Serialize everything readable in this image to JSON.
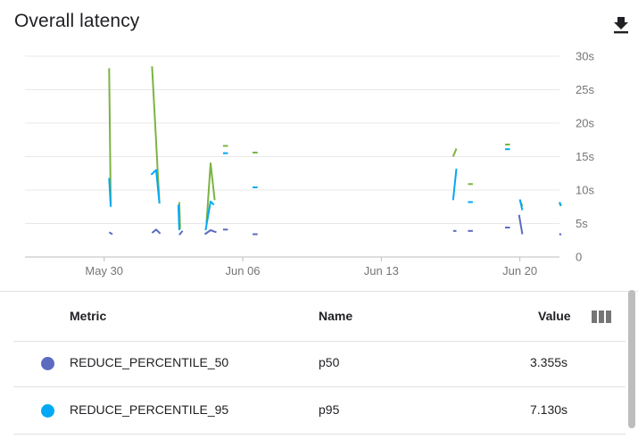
{
  "header": {
    "title": "Overall latency",
    "download_icon": "download-icon"
  },
  "chart_data": {
    "type": "line",
    "title": "",
    "xlabel": "",
    "ylabel": "",
    "x_ticks": [
      "May 30",
      "Jun 06",
      "Jun 13",
      "Jun 20"
    ],
    "y_ticks": [
      "0",
      "5s",
      "10s",
      "15s",
      "20s",
      "25s",
      "30s"
    ],
    "ylim": [
      0,
      30
    ],
    "xlim": [
      "2024-05-26",
      "2024-06-22"
    ],
    "grid": true,
    "y_axis_position": "right",
    "series": [
      {
        "color": "#7cb342",
        "segments": [
          [
            [
              "2024-05-30T06:00",
              28.2
            ],
            [
              "2024-05-30T08:00",
              7.8
            ]
          ],
          [
            [
              "2024-06-01T10:00",
              28.5
            ],
            [
              "2024-06-01T19:00",
              8.0
            ]
          ],
          [
            [
              "2024-06-02T19:00",
              8.2
            ],
            [
              "2024-06-02T20:00",
              4.2
            ]
          ],
          [
            [
              "2024-06-04T04:00",
              5.0
            ],
            [
              "2024-06-04T09:00",
              14.0
            ],
            [
              "2024-06-04T14:00",
              8.5
            ]
          ],
          [
            [
              "2024-06-05T00:00",
              16.6
            ],
            [
              "2024-06-05T06:00",
              16.6
            ]
          ],
          [
            [
              "2024-06-06T12:00",
              15.6
            ],
            [
              "2024-06-06T18:00",
              15.6
            ]
          ],
          [
            [
              "2024-06-16T15:00",
              15.0
            ],
            [
              "2024-06-16T19:00",
              16.2
            ]
          ],
          [
            [
              "2024-06-17T09:00",
              10.9
            ],
            [
              "2024-06-17T15:00",
              10.9
            ]
          ],
          [
            [
              "2024-06-19T06:00",
              16.8
            ],
            [
              "2024-06-19T12:00",
              16.8
            ]
          ],
          [
            [
              "2024-06-20T00:00",
              8.5
            ],
            [
              "2024-06-20T03:00",
              7.6
            ]
          ],
          [
            [
              "2024-06-22T00:00",
              8.0
            ],
            [
              "2024-06-22T02:00",
              7.6
            ]
          ]
        ]
      },
      {
        "color": "#03a9f4",
        "segments": [
          [
            [
              "2024-05-30T06:00",
              11.8
            ],
            [
              "2024-05-30T08:00",
              7.5
            ]
          ],
          [
            [
              "2024-06-01T09:00",
              12.3
            ],
            [
              "2024-06-01T15:00",
              13.0
            ],
            [
              "2024-06-01T19:00",
              8.0
            ]
          ],
          [
            [
              "2024-06-02T18:00",
              7.8
            ],
            [
              "2024-06-02T19:00",
              4.0
            ]
          ],
          [
            [
              "2024-06-04T03:00",
              4.0
            ],
            [
              "2024-06-04T09:00",
              8.3
            ],
            [
              "2024-06-04T13:00",
              7.8
            ]
          ],
          [
            [
              "2024-06-05T00:00",
              15.5
            ],
            [
              "2024-06-05T06:00",
              15.5
            ]
          ],
          [
            [
              "2024-06-06T12:00",
              10.4
            ],
            [
              "2024-06-06T18:00",
              10.4
            ]
          ],
          [
            [
              "2024-06-16T15:00",
              8.5
            ],
            [
              "2024-06-16T19:00",
              13.2
            ]
          ],
          [
            [
              "2024-06-17T09:00",
              8.2
            ],
            [
              "2024-06-17T15:00",
              8.2
            ]
          ],
          [
            [
              "2024-06-19T06:00",
              16.1
            ],
            [
              "2024-06-19T12:00",
              16.1
            ]
          ],
          [
            [
              "2024-06-20T00:00",
              8.6
            ],
            [
              "2024-06-20T03:00",
              7.0
            ]
          ],
          [
            [
              "2024-06-22T00:00",
              8.2
            ],
            [
              "2024-06-22T02:00",
              7.7
            ]
          ]
        ]
      },
      {
        "color": "#5c6bc0",
        "segments": [
          [
            [
              "2024-05-30T06:00",
              3.7
            ],
            [
              "2024-05-30T10:00",
              3.4
            ]
          ],
          [
            [
              "2024-06-01T10:00",
              3.6
            ],
            [
              "2024-06-01T15:00",
              4.1
            ],
            [
              "2024-06-01T20:00",
              3.5
            ]
          ],
          [
            [
              "2024-06-02T19:00",
              3.3
            ],
            [
              "2024-06-02T23:00",
              3.9
            ]
          ],
          [
            [
              "2024-06-04T02:00",
              3.4
            ],
            [
              "2024-06-04T09:00",
              4.0
            ],
            [
              "2024-06-04T16:00",
              3.7
            ]
          ],
          [
            [
              "2024-06-05T00:00",
              4.1
            ],
            [
              "2024-06-05T06:00",
              4.1
            ]
          ],
          [
            [
              "2024-06-06T12:00",
              3.4
            ],
            [
              "2024-06-06T18:00",
              3.4
            ]
          ],
          [
            [
              "2024-06-16T15:00",
              3.9
            ],
            [
              "2024-06-16T19:00",
              3.9
            ]
          ],
          [
            [
              "2024-06-17T09:00",
              3.9
            ],
            [
              "2024-06-17T15:00",
              3.9
            ]
          ],
          [
            [
              "2024-06-19T06:00",
              4.4
            ],
            [
              "2024-06-19T12:00",
              4.4
            ]
          ],
          [
            [
              "2024-06-19T23:00",
              6.3
            ],
            [
              "2024-06-20T03:00",
              3.4
            ]
          ],
          [
            [
              "2024-06-22T00:00",
              3.5
            ],
            [
              "2024-06-22T02:00",
              3.3
            ]
          ]
        ]
      }
    ]
  },
  "table": {
    "columns": [
      "Metric",
      "Name",
      "Value"
    ],
    "columns_icon": "view-columns-icon",
    "rows": [
      {
        "color": "#5c6bc0",
        "metric": "REDUCE_PERCENTILE_50",
        "name": "p50",
        "value": "3.355s"
      },
      {
        "color": "#03a9f4",
        "metric": "REDUCE_PERCENTILE_95",
        "name": "p95",
        "value": "7.130s"
      }
    ]
  }
}
